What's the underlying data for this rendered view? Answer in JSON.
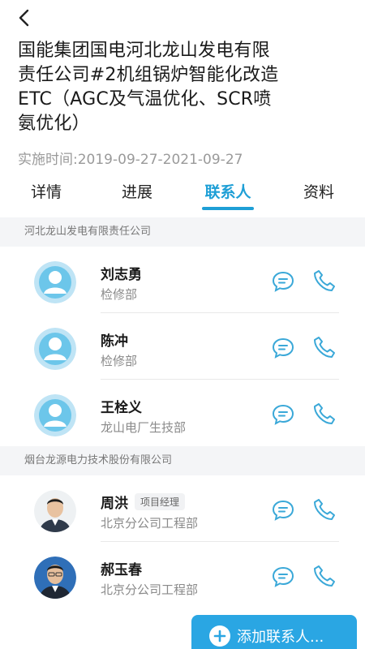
{
  "header": {
    "title": "国能集团国电河北龙山发电有限责任公司#2机组锅炉智能化改造ETC（AGC及气温优化、SCR喷氨优化）",
    "period": "实施时间:2019-09-27-2021-09-27"
  },
  "tabs": [
    {
      "label": "详情"
    },
    {
      "label": "进展"
    },
    {
      "label": "联系人"
    },
    {
      "label": "资料"
    }
  ],
  "active_tab": "联系人",
  "groups": [
    {
      "company": "河北龙山发电有限责任公司",
      "contacts": [
        {
          "name": "刘志勇",
          "dept": "检修部"
        },
        {
          "name": "陈冲",
          "dept": "检修部"
        },
        {
          "name": "王栓义",
          "dept": "龙山电厂生技部"
        }
      ]
    },
    {
      "company": "烟台龙源电力技术股份有限公司",
      "contacts": [
        {
          "name": "周洪",
          "role": "项目经理",
          "dept": "北京分公司工程部"
        },
        {
          "name": "郝玉春",
          "dept": "北京分公司工程部"
        }
      ]
    }
  ],
  "add_button": {
    "label": "添加联系人..."
  },
  "colors": {
    "accent": "#1e9fd6",
    "button": "#2aa6e3",
    "icon": "#3aa8d8"
  }
}
